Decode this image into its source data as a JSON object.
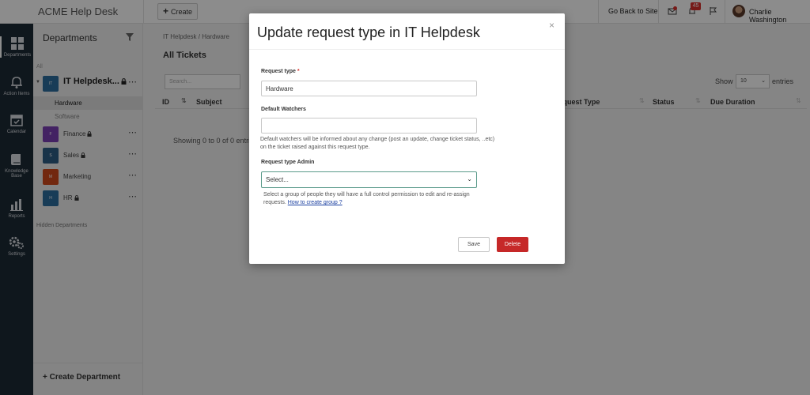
{
  "topbar": {
    "app_title": "ACME Help Desk",
    "create_label": "Create",
    "go_back_label": "Go Back to Site",
    "notifications_count": "45",
    "user_name": "Charlie Washington"
  },
  "rail": {
    "items": [
      {
        "label": "Departments",
        "icon": "grid-icon"
      },
      {
        "label": "Action Items",
        "icon": "bell-icon"
      },
      {
        "label": "Calendar",
        "icon": "calendar-icon"
      },
      {
        "label": "Knowledge",
        "label2": "Base",
        "icon": "book-icon"
      },
      {
        "label": "Reports",
        "icon": "chart-icon"
      },
      {
        "label": "Settings",
        "icon": "gear-icon"
      }
    ]
  },
  "departments": {
    "title": "Departments",
    "all_label": "All",
    "items": [
      {
        "name": "IT Helpdesk...",
        "logo": "IT",
        "color": "#2d6e9e"
      },
      {
        "name": "Finance",
        "logo": "F",
        "color": "#7b3fb5"
      },
      {
        "name": "Sales",
        "logo": "S",
        "color": "#2d5e86"
      },
      {
        "name": "Marketing",
        "logo": "M",
        "color": "#d04a1c"
      },
      {
        "name": "HR",
        "logo": "H",
        "color": "#2d6e9e"
      }
    ],
    "sub_items": [
      "Hardware",
      "Software"
    ],
    "hidden_label": "Hidden Departments",
    "create_label": "+ Create Department"
  },
  "main": {
    "breadcrumb": "IT Helpdesk / Hardware",
    "title": "All Tickets",
    "search_placeholder": "Search...",
    "show_label": "Show",
    "show_value": "10",
    "entries_label": "entries",
    "columns": [
      "ID",
      "Subject",
      "Request Type",
      "Status",
      "Due Duration"
    ],
    "showing_text": "Showing 0 to 0 of 0 entries"
  },
  "modal": {
    "title": "Update request type in IT Helpdesk",
    "request_type_label": "Request type",
    "request_type_required": "*",
    "request_type_value": "Hardware",
    "watchers_label": "Default Watchers",
    "watchers_value": "",
    "watchers_help": "Default watchers will be informed about any change (post an update, change ticket status, ..etc) on the ticket raised against this request type.",
    "admin_label": "Request type Admin",
    "admin_placeholder": "Select...",
    "admin_help": "Select a group of people they will have a full control permission to edit and re-assign requests.",
    "admin_help_link": "How to create group ?",
    "save_label": "Save",
    "delete_label": "Delete",
    "close_glyph": "×"
  }
}
